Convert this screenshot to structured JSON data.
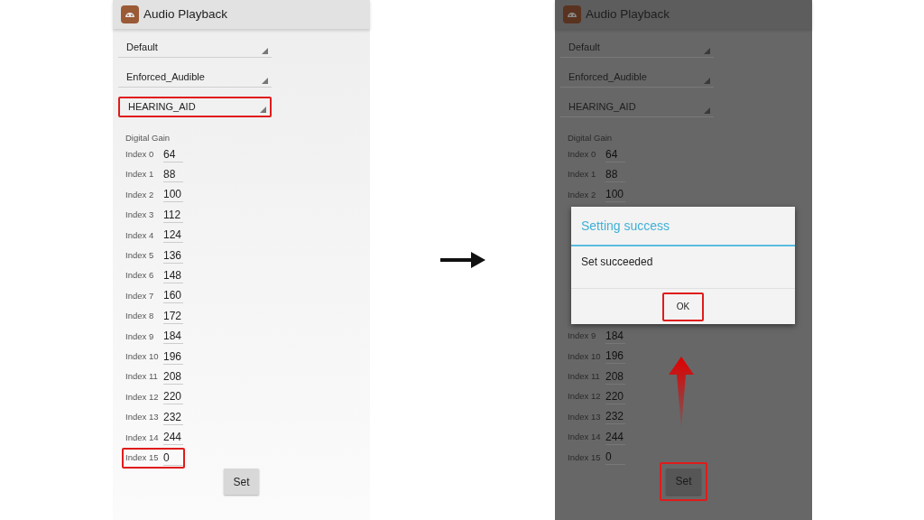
{
  "screens": [
    {
      "title": "Audio Playback",
      "dimmed": false,
      "dropdowns": [
        {
          "value": "Default",
          "highlighted": false
        },
        {
          "value": "Enforced_Audible",
          "highlighted": false
        },
        {
          "value": "HEARING_AID",
          "highlighted": true
        }
      ],
      "section_label": "Digital Gain",
      "gains": [
        {
          "label": "Index 0",
          "value": "64",
          "highlighted": false
        },
        {
          "label": "Index 1",
          "value": "88",
          "highlighted": false
        },
        {
          "label": "Index 2",
          "value": "100",
          "highlighted": false
        },
        {
          "label": "Index 3",
          "value": "112",
          "highlighted": false
        },
        {
          "label": "Index 4",
          "value": "124",
          "highlighted": false
        },
        {
          "label": "Index 5",
          "value": "136",
          "highlighted": false
        },
        {
          "label": "Index 6",
          "value": "148",
          "highlighted": false
        },
        {
          "label": "Index 7",
          "value": "160",
          "highlighted": false
        },
        {
          "label": "Index 8",
          "value": "172",
          "highlighted": false
        },
        {
          "label": "Index 9",
          "value": "184",
          "highlighted": false
        },
        {
          "label": "Index 10",
          "value": "196",
          "highlighted": false
        },
        {
          "label": "Index 11",
          "value": "208",
          "highlighted": false
        },
        {
          "label": "Index 12",
          "value": "220",
          "highlighted": false
        },
        {
          "label": "Index 13",
          "value": "232",
          "highlighted": false
        },
        {
          "label": "Index 14",
          "value": "244",
          "highlighted": false
        },
        {
          "label": "Index 15",
          "value": "0",
          "highlighted": true
        }
      ],
      "set_button": {
        "label": "Set",
        "highlighted": false
      }
    },
    {
      "title": "Audio Playback",
      "dimmed": true,
      "dropdowns": [
        {
          "value": "Default",
          "highlighted": false
        },
        {
          "value": "Enforced_Audible",
          "highlighted": false
        },
        {
          "value": "HEARING_AID",
          "highlighted": false
        }
      ],
      "section_label": "Digital Gain",
      "gains": [
        {
          "label": "Index 0",
          "value": "64",
          "highlighted": false
        },
        {
          "label": "Index 1",
          "value": "88",
          "highlighted": false
        },
        {
          "label": "Index 2",
          "value": "100",
          "highlighted": false
        }
      ],
      "dialog": {
        "title": "Setting success",
        "message": "Set succeeded",
        "button": {
          "label": "OK",
          "highlighted": true
        }
      },
      "gains_after": [
        {
          "label": "Index 9",
          "value": "184",
          "highlighted": false
        },
        {
          "label": "Index 10",
          "value": "196",
          "highlighted": false
        },
        {
          "label": "Index 11",
          "value": "208",
          "highlighted": false
        },
        {
          "label": "Index 12",
          "value": "220",
          "highlighted": false
        },
        {
          "label": "Index 13",
          "value": "232",
          "highlighted": false
        },
        {
          "label": "Index 14",
          "value": "244",
          "highlighted": false
        },
        {
          "label": "Index 15",
          "value": "0",
          "highlighted": false
        }
      ],
      "set_button": {
        "label": "Set",
        "highlighted": true
      },
      "pointer_arrow": true
    }
  ]
}
